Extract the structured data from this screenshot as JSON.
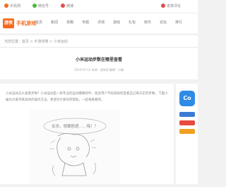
{
  "topbar": {
    "items": [
      {
        "label": "手机网",
        "color": "#f36b21"
      },
      {
        "label": "微信号",
        "color": "#4cbb3b"
      },
      {
        "label": "微博",
        "color": "#e34d4d"
      }
    ],
    "right_label": "发表评论"
  },
  "header": {
    "logo_badge": "游侠",
    "logo_text": "手机游戏",
    "nav": [
      "首页",
      "新闻",
      "攻略",
      "专题",
      "评测",
      "游戏",
      "礼包",
      "软件",
      "论坛",
      "排行"
    ]
  },
  "breadcrumb": "当前位置：首页 > 手游攻略 > 小米运动",
  "article": {
    "title": "小米运动步数在哪里查看",
    "meta": "2024-03-12  来源：游侠网  编辑：小编",
    "paragraph": "小米运动怎么查看步数？小米运动是一款专业的运动健康软件，很多用户不知道如何查看自己每天走的步数，下面小编为大家带来具体的操作方法，希望对大家有所帮助，一起来看看吧。",
    "figure_caption": "女孩，想要剧透……嗨！？"
  },
  "sidebar": {
    "app_icon_label": "Co",
    "button_colors": [
      "#3a7bd5",
      "#e94b3c",
      "#f0a020"
    ]
  }
}
